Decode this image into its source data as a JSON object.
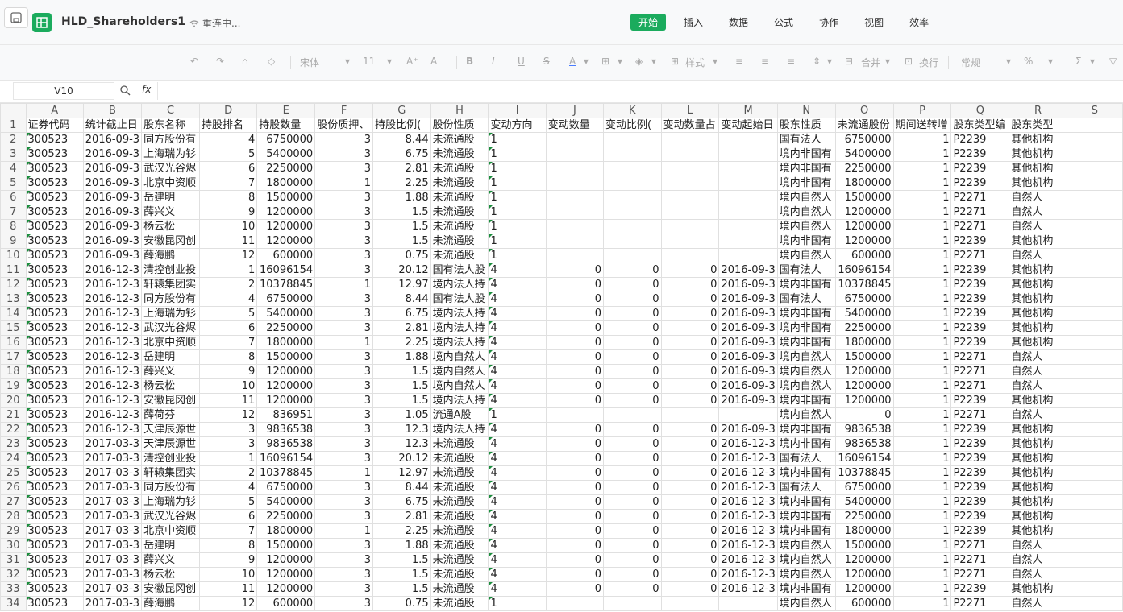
{
  "window": {
    "title": "HLD_Shareholders1",
    "status": "重连中..."
  },
  "menu": [
    "开始",
    "插入",
    "数据",
    "公式",
    "协作",
    "视图",
    "效率"
  ],
  "menu_active": 0,
  "toolbar": {
    "font_name": "宋体",
    "font_size": "11",
    "style_label": "样式",
    "merge_label": "合并",
    "wrap_label": "换行",
    "number_format": "常规",
    "font_size_up": "A⁺",
    "font_size_down": "A⁻"
  },
  "formula_bar": {
    "cell_ref": "V10",
    "fx_label": "fx",
    "value": ""
  },
  "columns": [
    "A",
    "B",
    "C",
    "D",
    "E",
    "F",
    "G",
    "H",
    "I",
    "J",
    "K",
    "L",
    "M",
    "N",
    "O",
    "P",
    "Q",
    "R",
    "S"
  ],
  "rows": [
    [
      "证券代码",
      "统计截止日",
      "股东名称",
      "持股排名",
      "持股数量",
      "股份质押、",
      "持股比例(",
      "股份性质",
      "变动方向",
      "变动数量",
      "变动比例(",
      "变动数量占",
      "变动起始日",
      "股东性质",
      "未流通股份",
      "期间送转增",
      "股东类型编",
      "股东类型",
      ""
    ],
    [
      "300523",
      "2016-09-3",
      "同方股份有",
      "4",
      "6750000",
      "3",
      "8.44",
      "未流通股",
      "1",
      "",
      "",
      "",
      "",
      "国有法人",
      "6750000",
      "1",
      "P2239",
      "其他机构",
      ""
    ],
    [
      "300523",
      "2016-09-3",
      "上海瑞为钐",
      "5",
      "5400000",
      "3",
      "6.75",
      "未流通股",
      "1",
      "",
      "",
      "",
      "",
      "境内非国有",
      "5400000",
      "1",
      "P2239",
      "其他机构",
      ""
    ],
    [
      "300523",
      "2016-09-3",
      "武汉光谷烬",
      "6",
      "2250000",
      "3",
      "2.81",
      "未流通股",
      "1",
      "",
      "",
      "",
      "",
      "境内非国有",
      "2250000",
      "1",
      "P2239",
      "其他机构",
      ""
    ],
    [
      "300523",
      "2016-09-3",
      "北京中资顺",
      "7",
      "1800000",
      "1",
      "2.25",
      "未流通股",
      "1",
      "",
      "",
      "",
      "",
      "境内非国有",
      "1800000",
      "1",
      "P2239",
      "其他机构",
      ""
    ],
    [
      "300523",
      "2016-09-3",
      "岳建明",
      "8",
      "1500000",
      "3",
      "1.88",
      "未流通股",
      "1",
      "",
      "",
      "",
      "",
      "境内自然人",
      "1500000",
      "1",
      "P2271",
      "自然人",
      ""
    ],
    [
      "300523",
      "2016-09-3",
      "薛兴义",
      "9",
      "1200000",
      "3",
      "1.5",
      "未流通股",
      "1",
      "",
      "",
      "",
      "",
      "境内自然人",
      "1200000",
      "1",
      "P2271",
      "自然人",
      ""
    ],
    [
      "300523",
      "2016-09-3",
      "杨云松",
      "10",
      "1200000",
      "3",
      "1.5",
      "未流通股",
      "1",
      "",
      "",
      "",
      "",
      "境内自然人",
      "1200000",
      "1",
      "P2271",
      "自然人",
      ""
    ],
    [
      "300523",
      "2016-09-3",
      "安徽昆冈创",
      "11",
      "1200000",
      "3",
      "1.5",
      "未流通股",
      "1",
      "",
      "",
      "",
      "",
      "境内非国有",
      "1200000",
      "1",
      "P2239",
      "其他机构",
      ""
    ],
    [
      "300523",
      "2016-09-3",
      "薛海鹏",
      "12",
      "600000",
      "3",
      "0.75",
      "未流通股",
      "1",
      "",
      "",
      "",
      "",
      "境内自然人",
      "600000",
      "1",
      "P2271",
      "自然人",
      ""
    ],
    [
      "300523",
      "2016-12-3",
      "清控创业投",
      "1",
      "16096154",
      "3",
      "20.12",
      "国有法人股",
      "4",
      "0",
      "0",
      "0",
      "2016-09-3",
      "国有法人",
      "16096154",
      "1",
      "P2239",
      "其他机构",
      ""
    ],
    [
      "300523",
      "2016-12-3",
      "轩辕集团实",
      "2",
      "10378845",
      "1",
      "12.97",
      "境内法人持",
      "4",
      "0",
      "0",
      "0",
      "2016-09-3",
      "境内非国有",
      "10378845",
      "1",
      "P2239",
      "其他机构",
      ""
    ],
    [
      "300523",
      "2016-12-3",
      "同方股份有",
      "4",
      "6750000",
      "3",
      "8.44",
      "国有法人股",
      "4",
      "0",
      "0",
      "0",
      "2016-09-3",
      "国有法人",
      "6750000",
      "1",
      "P2239",
      "其他机构",
      ""
    ],
    [
      "300523",
      "2016-12-3",
      "上海瑞为钐",
      "5",
      "5400000",
      "3",
      "6.75",
      "境内法人持",
      "4",
      "0",
      "0",
      "0",
      "2016-09-3",
      "境内非国有",
      "5400000",
      "1",
      "P2239",
      "其他机构",
      ""
    ],
    [
      "300523",
      "2016-12-3",
      "武汉光谷烬",
      "6",
      "2250000",
      "3",
      "2.81",
      "境内法人持",
      "4",
      "0",
      "0",
      "0",
      "2016-09-3",
      "境内非国有",
      "2250000",
      "1",
      "P2239",
      "其他机构",
      ""
    ],
    [
      "300523",
      "2016-12-3",
      "北京中资顺",
      "7",
      "1800000",
      "1",
      "2.25",
      "境内法人持",
      "4",
      "0",
      "0",
      "0",
      "2016-09-3",
      "境内非国有",
      "1800000",
      "1",
      "P2239",
      "其他机构",
      ""
    ],
    [
      "300523",
      "2016-12-3",
      "岳建明",
      "8",
      "1500000",
      "3",
      "1.88",
      "境内自然人",
      "4",
      "0",
      "0",
      "0",
      "2016-09-3",
      "境内自然人",
      "1500000",
      "1",
      "P2271",
      "自然人",
      ""
    ],
    [
      "300523",
      "2016-12-3",
      "薛兴义",
      "9",
      "1200000",
      "3",
      "1.5",
      "境内自然人",
      "4",
      "0",
      "0",
      "0",
      "2016-09-3",
      "境内自然人",
      "1200000",
      "1",
      "P2271",
      "自然人",
      ""
    ],
    [
      "300523",
      "2016-12-3",
      "杨云松",
      "10",
      "1200000",
      "3",
      "1.5",
      "境内自然人",
      "4",
      "0",
      "0",
      "0",
      "2016-09-3",
      "境内自然人",
      "1200000",
      "1",
      "P2271",
      "自然人",
      ""
    ],
    [
      "300523",
      "2016-12-3",
      "安徽昆冈创",
      "11",
      "1200000",
      "3",
      "1.5",
      "境内法人持",
      "4",
      "0",
      "0",
      "0",
      "2016-09-3",
      "境内非国有",
      "1200000",
      "1",
      "P2239",
      "其他机构",
      ""
    ],
    [
      "300523",
      "2016-12-3",
      "薛荷芬",
      "12",
      "836951",
      "3",
      "1.05",
      "流通A股",
      "1",
      "",
      "",
      "",
      "",
      "境内自然人",
      "0",
      "1",
      "P2271",
      "自然人",
      ""
    ],
    [
      "300523",
      "2016-12-3",
      "天津辰源世",
      "3",
      "9836538",
      "3",
      "12.3",
      "境内法人持",
      "4",
      "0",
      "0",
      "0",
      "2016-09-3",
      "境内非国有",
      "9836538",
      "1",
      "P2239",
      "其他机构",
      ""
    ],
    [
      "300523",
      "2017-03-3",
      "天津辰源世",
      "3",
      "9836538",
      "3",
      "12.3",
      "未流通股",
      "4",
      "0",
      "0",
      "0",
      "2016-12-3",
      "境内非国有",
      "9836538",
      "1",
      "P2239",
      "其他机构",
      ""
    ],
    [
      "300523",
      "2017-03-3",
      "清控创业投",
      "1",
      "16096154",
      "3",
      "20.12",
      "未流通股",
      "4",
      "0",
      "0",
      "0",
      "2016-12-3",
      "国有法人",
      "16096154",
      "1",
      "P2239",
      "其他机构",
      ""
    ],
    [
      "300523",
      "2017-03-3",
      "轩辕集团实",
      "2",
      "10378845",
      "1",
      "12.97",
      "未流通股",
      "4",
      "0",
      "0",
      "0",
      "2016-12-3",
      "境内非国有",
      "10378845",
      "1",
      "P2239",
      "其他机构",
      ""
    ],
    [
      "300523",
      "2017-03-3",
      "同方股份有",
      "4",
      "6750000",
      "3",
      "8.44",
      "未流通股",
      "4",
      "0",
      "0",
      "0",
      "2016-12-3",
      "国有法人",
      "6750000",
      "1",
      "P2239",
      "其他机构",
      ""
    ],
    [
      "300523",
      "2017-03-3",
      "上海瑞为钐",
      "5",
      "5400000",
      "3",
      "6.75",
      "未流通股",
      "4",
      "0",
      "0",
      "0",
      "2016-12-3",
      "境内非国有",
      "5400000",
      "1",
      "P2239",
      "其他机构",
      ""
    ],
    [
      "300523",
      "2017-03-3",
      "武汉光谷烬",
      "6",
      "2250000",
      "3",
      "2.81",
      "未流通股",
      "4",
      "0",
      "0",
      "0",
      "2016-12-3",
      "境内非国有",
      "2250000",
      "1",
      "P2239",
      "其他机构",
      ""
    ],
    [
      "300523",
      "2017-03-3",
      "北京中资顺",
      "7",
      "1800000",
      "1",
      "2.25",
      "未流通股",
      "4",
      "0",
      "0",
      "0",
      "2016-12-3",
      "境内非国有",
      "1800000",
      "1",
      "P2239",
      "其他机构",
      ""
    ],
    [
      "300523",
      "2017-03-3",
      "岳建明",
      "8",
      "1500000",
      "3",
      "1.88",
      "未流通股",
      "4",
      "0",
      "0",
      "0",
      "2016-12-3",
      "境内自然人",
      "1500000",
      "1",
      "P2271",
      "自然人",
      ""
    ],
    [
      "300523",
      "2017-03-3",
      "薛兴义",
      "9",
      "1200000",
      "3",
      "1.5",
      "未流通股",
      "4",
      "0",
      "0",
      "0",
      "2016-12-3",
      "境内自然人",
      "1200000",
      "1",
      "P2271",
      "自然人",
      ""
    ],
    [
      "300523",
      "2017-03-3",
      "杨云松",
      "10",
      "1200000",
      "3",
      "1.5",
      "未流通股",
      "4",
      "0",
      "0",
      "0",
      "2016-12-3",
      "境内自然人",
      "1200000",
      "1",
      "P2271",
      "自然人",
      ""
    ],
    [
      "300523",
      "2017-03-3",
      "安徽昆冈创",
      "11",
      "1200000",
      "3",
      "1.5",
      "未流通股",
      "4",
      "0",
      "0",
      "0",
      "2016-12-3",
      "境内非国有",
      "1200000",
      "1",
      "P2239",
      "其他机构",
      ""
    ],
    [
      "300523",
      "2017-03-3",
      "薛海鹏",
      "12",
      "600000",
      "3",
      "0.75",
      "未流通股",
      "1",
      "",
      "",
      "",
      "",
      "境内自然人",
      "600000",
      "1",
      "P2271",
      "自然人",
      ""
    ]
  ]
}
